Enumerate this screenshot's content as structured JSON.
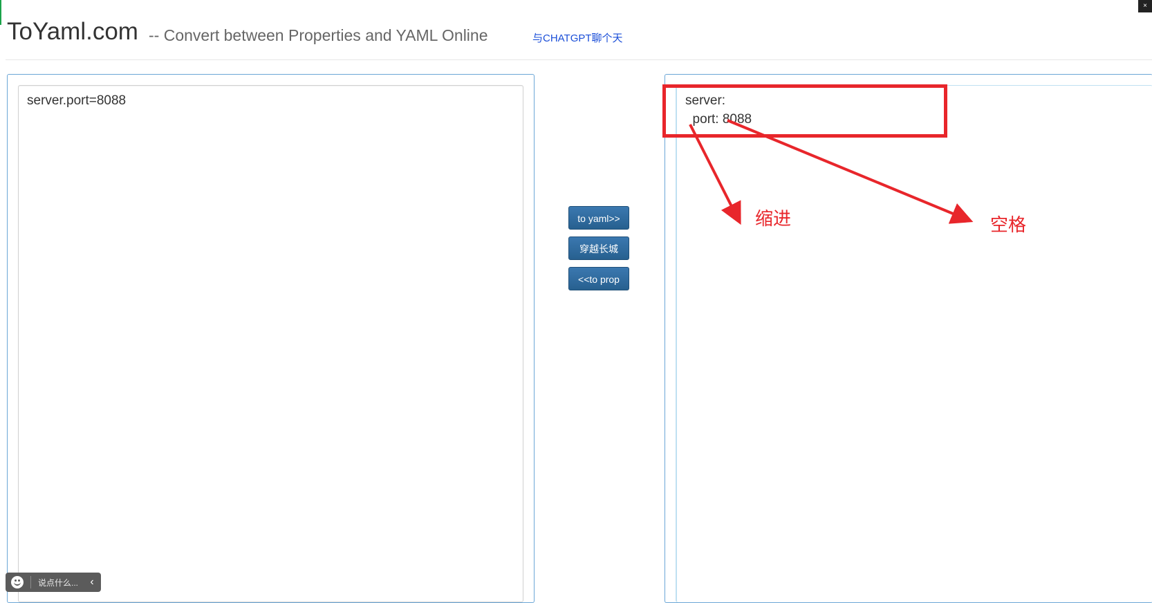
{
  "header": {
    "brand": "ToYaml.com",
    "subtitle": "-- Convert between Properties and YAML Online",
    "chat_link": "与CHATGPT聊个天"
  },
  "left_editor": {
    "value": "server.port=8088"
  },
  "right_editor": {
    "value": "server:\n  port: 8088"
  },
  "buttons": {
    "to_yaml": "to yaml>>",
    "cross_wall": "穿越长城",
    "to_prop": "<<to prop"
  },
  "annotations": {
    "indent_label": "缩进",
    "space_label": "空格",
    "color": "#e8262b"
  },
  "chat_widget": {
    "placeholder": "说点什么...",
    "emoji_icon": "smile-icon",
    "collapse_icon": "chevron-left-icon"
  },
  "colors": {
    "panel_border": "#6aa6d6",
    "button_bg": "#2d6ca2",
    "link": "#1a4ed8"
  }
}
